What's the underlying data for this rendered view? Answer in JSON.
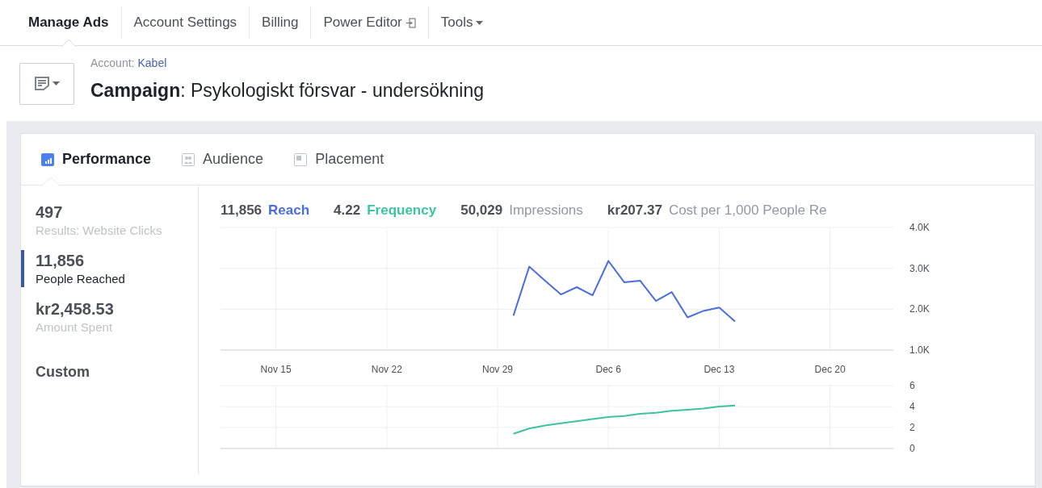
{
  "nav": [
    {
      "label": "Manage Ads",
      "selected": true,
      "kind": "plain"
    },
    {
      "label": "Account Settings",
      "selected": false,
      "kind": "plain"
    },
    {
      "label": "Billing",
      "selected": false,
      "kind": "plain"
    },
    {
      "label": "Power Editor",
      "selected": false,
      "kind": "external"
    },
    {
      "label": "Tools",
      "selected": false,
      "kind": "menu"
    }
  ],
  "header": {
    "account_label": "Account:",
    "account_name": "Kabel",
    "title_label": "Campaign",
    "title_rest": ": Psykologiskt försvar - undersökning"
  },
  "tabs": [
    {
      "label": "Performance",
      "selected": true,
      "kind": "performance"
    },
    {
      "label": "Audience",
      "selected": false,
      "kind": "audience"
    },
    {
      "label": "Placement",
      "selected": false,
      "kind": "placement"
    }
  ],
  "metrics": [
    {
      "value": "497",
      "label": "Results: Website Clicks",
      "selected": false
    },
    {
      "value": "11,856",
      "label": "People Reached",
      "selected": true
    },
    {
      "value": "kr2,458.53",
      "label": "Amount Spent",
      "selected": false
    }
  ],
  "custom": "Custom",
  "summary": [
    {
      "value": "11,856",
      "color": "#4a6ee0"
    },
    {
      "value": "4.22",
      "color": "#3cc4a2"
    },
    {
      "value": "50,029",
      "name": "Impressions",
      "color": "#9197a3"
    },
    {
      "value": "kr207.37",
      "name": "Cost per 1,000 People Re",
      "color": "#9197a3"
    }
  ],
  "reach_chart": {
    "chart_data": {
      "type": "line",
      "categories": [
        null,
        null,
        null,
        "Nov 15",
        null,
        null,
        null,
        null,
        null,
        null,
        "Nov 22",
        null,
        null,
        null,
        null,
        null,
        null,
        "Nov 29",
        null,
        null,
        null,
        null,
        null,
        null,
        "Dec 6",
        null,
        null,
        null,
        null,
        null,
        null,
        "Dec 13",
        null,
        null,
        null,
        null,
        null,
        null,
        "Dec 20",
        null,
        null,
        null
      ],
      "series": [
        {
          "name": "Reach",
          "color": "#4a6ee0",
          "values": [
            null,
            null,
            null,
            null,
            null,
            null,
            null,
            null,
            null,
            null,
            null,
            null,
            null,
            null,
            null,
            null,
            null,
            null,
            1840,
            3040,
            2700,
            2360,
            2540,
            2340,
            3180,
            2660,
            2700,
            2200,
            2420,
            1800,
            1960,
            2040,
            1700,
            null,
            null,
            null,
            null,
            null,
            null,
            null,
            null,
            null
          ]
        }
      ],
      "ylim": [
        1000,
        4000
      ],
      "grid": true,
      "yticks": [
        {
          "value": 1000,
          "label": "1.0K"
        },
        {
          "value": 2000,
          "label": "2.0K"
        },
        {
          "value": 3000,
          "label": "3.0K"
        },
        {
          "value": 4000,
          "label": "4.0K"
        }
      ]
    }
  },
  "frequency_chart": {
    "chart_data": {
      "type": "line",
      "series": [
        {
          "name": "Frequency",
          "color": "#3cc4a2",
          "values": [
            null,
            null,
            null,
            null,
            null,
            null,
            null,
            null,
            null,
            null,
            null,
            null,
            null,
            null,
            null,
            null,
            null,
            null,
            1.4,
            1.9,
            2.2,
            2.4,
            2.6,
            2.8,
            3.0,
            3.1,
            3.3,
            3.4,
            3.6,
            3.7,
            3.8,
            4.0,
            4.1,
            null,
            null,
            null,
            null,
            null,
            null,
            null,
            null,
            null
          ]
        }
      ],
      "ylim": [
        0,
        6
      ],
      "grid": true,
      "yticks": [
        0,
        2,
        4,
        6
      ]
    }
  }
}
